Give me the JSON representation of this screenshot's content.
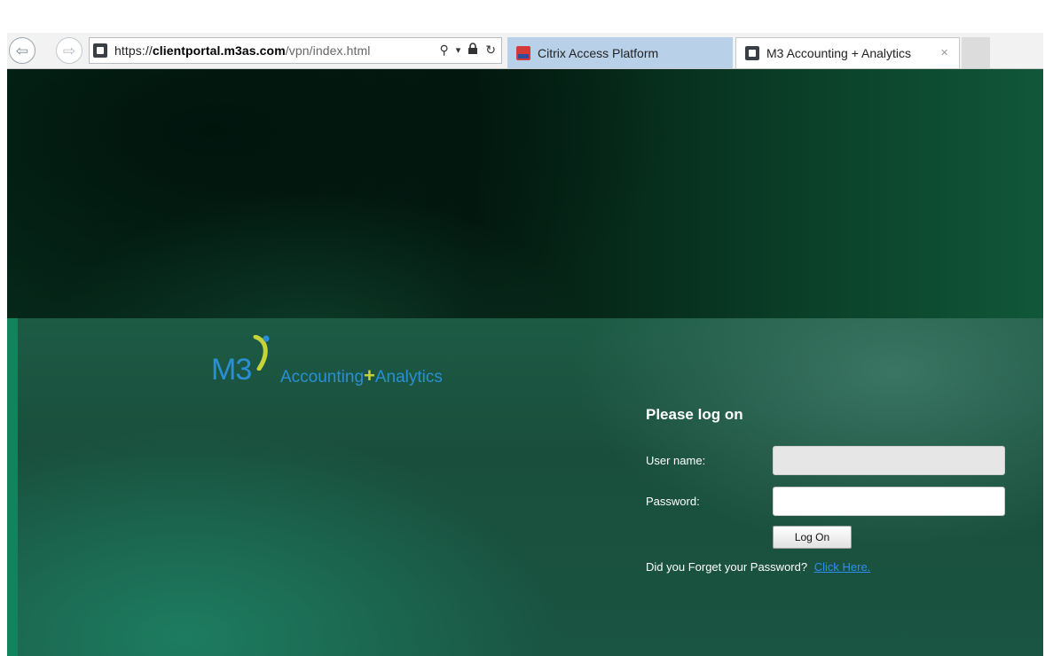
{
  "browser": {
    "back_icon": "back-arrow-icon",
    "forward_icon": "forward-arrow-icon",
    "address_bar": {
      "protocol": "https://",
      "host": "clientportal.m3as.com",
      "path": "/vpn/index.html",
      "search_icon": "search-icon",
      "dropdown_icon": "chevron-down-icon",
      "lock_icon": "lock-icon",
      "refresh_icon": "refresh-icon",
      "search_glyph": "⚲",
      "dropdown_glyph": "▾",
      "refresh_glyph": "↻"
    },
    "tabs": [
      {
        "label": "Citrix Access Platform",
        "active": false
      },
      {
        "label": "M3 Accounting + Analytics",
        "active": true,
        "close_glyph": "×"
      }
    ]
  },
  "logo": {
    "m3": "M3",
    "accounting": "Accounting",
    "plus": "+",
    "analytics": "Analytics",
    "colors": {
      "primary": "#2a8fd4",
      "accent": "#c6d43a"
    }
  },
  "login": {
    "title": "Please log on",
    "username_label": "User name:",
    "username_value": "",
    "password_label": "Password:",
    "password_value": "",
    "submit_label": "Log On",
    "forgot_text": "Did you Forget your Password?",
    "forgot_link": "Click Here."
  },
  "colors": {
    "hero_dark": "#031a10",
    "panel_green": "#1d5b45",
    "edge_accent": "#11845e",
    "link_blue": "#2f8ef4"
  }
}
